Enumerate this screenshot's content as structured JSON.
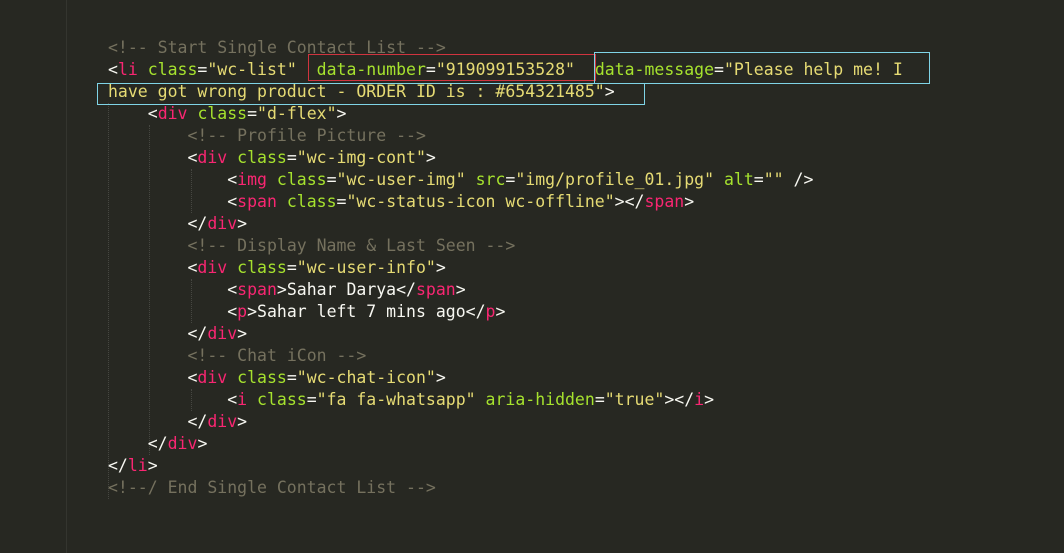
{
  "code": {
    "comment_start": "<!-- Start Single Contact List -->",
    "li_open_tag": "li",
    "li_class_value": "\"wc-list\"",
    "data_number_attr": "data-number",
    "data_number_value": "\"919099153528\"",
    "data_message_attr": "data-message",
    "data_message_value_part1": "\"Please help me! I",
    "data_message_value_part2": "have got wrong product - ORDER ID is : #654321485\"",
    "div_dflex_class": "\"d-flex\"",
    "comment_profile": "<!-- Profile Picture -->",
    "img_cont_class": "\"wc-img-cont\"",
    "img_class": "\"wc-user-img\"",
    "img_src": "\"img/profile_01.jpg\"",
    "img_alt": "\"\"",
    "status_icon_class": "\"wc-status-icon wc-offline\"",
    "comment_display": "<!-- Display Name & Last Seen -->",
    "user_info_class": "\"wc-user-info\"",
    "user_name": "Sahar Darya",
    "last_seen": "Sahar left 7 mins ago",
    "comment_chat": "<!-- Chat iCon -->",
    "chat_icon_class": "\"wc-chat-icon\"",
    "i_class": "\"fa fa-whatsapp\"",
    "aria_hidden_value": "\"true\"",
    "comment_end": "<!--/ End Single Contact List -->"
  },
  "colors": {
    "background": "#272822",
    "comment": "#75715e",
    "tag": "#f92672",
    "attribute": "#a6e22e",
    "string": "#e6db74",
    "highlight_red": "#d0343f",
    "highlight_cyan": "#7fd4e6"
  }
}
